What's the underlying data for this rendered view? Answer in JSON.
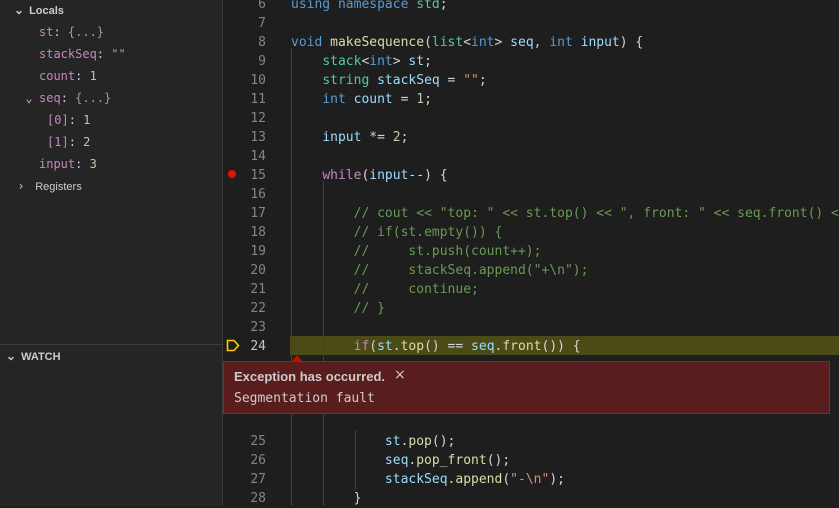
{
  "variables": {
    "locals_label": "Locals",
    "items": [
      {
        "name": "st",
        "sep": ": ",
        "value": "{...}",
        "kind": "obj"
      },
      {
        "name": "stackSeq",
        "sep": ": ",
        "value": "\"\"",
        "kind": "str"
      },
      {
        "name": "count",
        "sep": ": ",
        "value": "1",
        "kind": "num"
      },
      {
        "name": "seq",
        "sep": ": ",
        "value": "{...}",
        "kind": "obj",
        "expanded": true
      },
      {
        "name": "[0]",
        "sep": ": ",
        "value": "1",
        "kind": "num"
      },
      {
        "name": "[1]",
        "sep": ": ",
        "value": "2",
        "kind": "num"
      },
      {
        "name": "input",
        "sep": ": ",
        "value": "3",
        "kind": "num"
      }
    ],
    "registers_label": "Registers"
  },
  "watch": {
    "label": "WATCH"
  },
  "editor": {
    "lines": [
      {
        "n": "6",
        "tokens": [
          [
            "kw",
            "using"
          ],
          [
            "op",
            " "
          ],
          [
            "kw",
            "namespace"
          ],
          [
            "op",
            " "
          ],
          [
            "ty",
            "std"
          ],
          [
            "op",
            ";"
          ]
        ]
      },
      {
        "n": "7",
        "tokens": []
      },
      {
        "n": "8",
        "tokens": [
          [
            "kw",
            "void"
          ],
          [
            "op",
            " "
          ],
          [
            "fn",
            "makeSequence"
          ],
          [
            "op",
            "("
          ],
          [
            "ty",
            "list"
          ],
          [
            "op",
            "<"
          ],
          [
            "kw",
            "int"
          ],
          [
            "op",
            "> "
          ],
          [
            "var",
            "seq"
          ],
          [
            "op",
            ", "
          ],
          [
            "kw",
            "int"
          ],
          [
            "op",
            " "
          ],
          [
            "var",
            "input"
          ],
          [
            "op",
            ") {"
          ]
        ]
      },
      {
        "n": "9",
        "tokens": [
          [
            "op",
            "    "
          ],
          [
            "ty",
            "stack"
          ],
          [
            "op",
            "<"
          ],
          [
            "kw",
            "int"
          ],
          [
            "op",
            "> "
          ],
          [
            "var",
            "st"
          ],
          [
            "op",
            ";"
          ]
        ]
      },
      {
        "n": "10",
        "tokens": [
          [
            "op",
            "    "
          ],
          [
            "ty",
            "string"
          ],
          [
            "op",
            " "
          ],
          [
            "var",
            "stackSeq"
          ],
          [
            "op",
            " = "
          ],
          [
            "str",
            "\"\""
          ],
          [
            "op",
            ";"
          ]
        ]
      },
      {
        "n": "11",
        "tokens": [
          [
            "op",
            "    "
          ],
          [
            "kw",
            "int"
          ],
          [
            "op",
            " "
          ],
          [
            "var",
            "count"
          ],
          [
            "op",
            " = "
          ],
          [
            "num",
            "1"
          ],
          [
            "op",
            ";"
          ]
        ]
      },
      {
        "n": "12",
        "tokens": []
      },
      {
        "n": "13",
        "tokens": [
          [
            "op",
            "    "
          ],
          [
            "var",
            "input"
          ],
          [
            "op",
            " *= "
          ],
          [
            "num",
            "2"
          ],
          [
            "op",
            ";"
          ]
        ]
      },
      {
        "n": "14",
        "tokens": []
      },
      {
        "n": "15",
        "tokens": [
          [
            "op",
            "    "
          ],
          [
            "ctl",
            "while"
          ],
          [
            "op",
            "("
          ],
          [
            "var",
            "input"
          ],
          [
            "op",
            "--) {"
          ]
        ]
      },
      {
        "n": "16",
        "tokens": []
      },
      {
        "n": "17",
        "tokens": [
          [
            "op",
            "        "
          ],
          [
            "cmt",
            "// cout << \"top: \" << st.top() << \", front: \" << seq.front() <<"
          ]
        ]
      },
      {
        "n": "18",
        "tokens": [
          [
            "op",
            "        "
          ],
          [
            "cmt",
            "// if(st.empty()) {"
          ]
        ]
      },
      {
        "n": "19",
        "tokens": [
          [
            "op",
            "        "
          ],
          [
            "cmt",
            "//     st.push(count++);"
          ]
        ]
      },
      {
        "n": "20",
        "tokens": [
          [
            "op",
            "        "
          ],
          [
            "cmt",
            "//     stackSeq.append(\"+\\n\");"
          ]
        ]
      },
      {
        "n": "21",
        "tokens": [
          [
            "op",
            "        "
          ],
          [
            "cmt",
            "//     continue;"
          ]
        ]
      },
      {
        "n": "22",
        "tokens": [
          [
            "op",
            "        "
          ],
          [
            "cmt",
            "// }"
          ]
        ]
      },
      {
        "n": "23",
        "tokens": []
      },
      {
        "n": "24",
        "tokens": [
          [
            "op",
            "        "
          ],
          [
            "ctl",
            "if"
          ],
          [
            "op",
            "("
          ],
          [
            "var",
            "st"
          ],
          [
            "op",
            "."
          ],
          [
            "fn",
            "top"
          ],
          [
            "op",
            "() == "
          ],
          [
            "var",
            "seq"
          ],
          [
            "op",
            "."
          ],
          [
            "fn",
            "front"
          ],
          [
            "op",
            "()) {"
          ]
        ]
      },
      {
        "n": "25",
        "tokens": [
          [
            "op",
            "            "
          ],
          [
            "var",
            "st"
          ],
          [
            "op",
            "."
          ],
          [
            "fn",
            "pop"
          ],
          [
            "op",
            "();"
          ]
        ]
      },
      {
        "n": "26",
        "tokens": [
          [
            "op",
            "            "
          ],
          [
            "var",
            "seq"
          ],
          [
            "op",
            "."
          ],
          [
            "fn",
            "pop_front"
          ],
          [
            "op",
            "();"
          ]
        ]
      },
      {
        "n": "27",
        "tokens": [
          [
            "op",
            "            "
          ],
          [
            "var",
            "stackSeq"
          ],
          [
            "op",
            "."
          ],
          [
            "fn",
            "append"
          ],
          [
            "op",
            "("
          ],
          [
            "str",
            "\"-\\n\""
          ],
          [
            "op",
            ");"
          ]
        ]
      },
      {
        "n": "28",
        "tokens": [
          [
            "op",
            "        }"
          ]
        ]
      }
    ],
    "breakpoint_line": "15",
    "current_line": "24"
  },
  "exception": {
    "title": "Exception has occurred.",
    "close_icon": "×",
    "message": "Segmentation fault"
  },
  "colors": {
    "background": "#1e1e1e",
    "sidebar": "#252526",
    "current_line_highlight": "#4b4b18",
    "exception_bg": "#5a1d1d",
    "exception_border": "#be1100",
    "breakpoint": "#e51400"
  }
}
